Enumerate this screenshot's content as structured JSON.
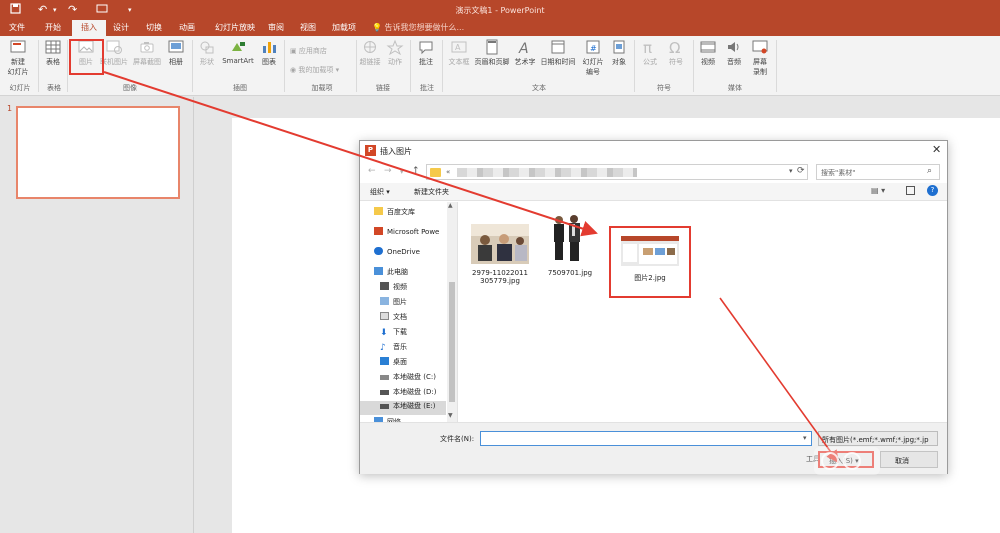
{
  "window": {
    "title": "演示文稿1 - PowerPoint"
  },
  "qat": {
    "save_icon": "save-icon",
    "undo_icon": "undo-icon",
    "redo_icon": "redo-icon",
    "present_icon": "present-icon"
  },
  "tabs": [
    "文件",
    "开始",
    "插入",
    "设计",
    "切换",
    "动画",
    "幻灯片放映",
    "审阅",
    "视图",
    "加载项"
  ],
  "tellme": "告诉我您想要做什么...",
  "ribbon": {
    "new_slide": "新建\n幻灯片",
    "table": "表格",
    "picture": "图片",
    "online_picture": "联机图片",
    "screenshot": "屏幕截图",
    "album": "相册",
    "shapes": "形状",
    "smartart": "SmartArt",
    "chart": "图表",
    "store": "应用商店",
    "my_addins": "我的加载项",
    "hyperlink": "超链接",
    "action": "动作",
    "comment": "批注",
    "textbox": "文本框",
    "header_footer": "页眉和页脚",
    "wordart": "艺术字",
    "datetime": "日期和时间",
    "slide_number": "幻灯片\n编号",
    "object": "对象",
    "equation": "公式",
    "symbol": "符号",
    "video": "视频",
    "audio": "音频",
    "screen_recording": "屏幕\n录制",
    "groups": {
      "slides": "幻灯片",
      "tables": "表格",
      "images": "图像",
      "illustrations": "插图",
      "addins": "加载项",
      "links": "链接",
      "comments": "批注",
      "text": "文本",
      "symbols": "符号",
      "media": "媒体"
    }
  },
  "thumbnails": {
    "slide_number": "1"
  },
  "dialog": {
    "title": "插入图片",
    "address_prefix": "«",
    "search_placeholder": "搜索\"素材\"",
    "organize": "组织 ▾",
    "new_folder": "新建文件夹",
    "nav": [
      {
        "label": "百度文库",
        "icon": "folder-icon"
      },
      {
        "label": "Microsoft Powe",
        "icon": "powerpoint-icon"
      },
      {
        "label": "OneDrive",
        "icon": "cloud-icon"
      },
      {
        "label": "此电脑",
        "icon": "computer-icon"
      },
      {
        "label": "视频",
        "icon": "video-folder-icon"
      },
      {
        "label": "图片",
        "icon": "pictures-folder-icon"
      },
      {
        "label": "文档",
        "icon": "documents-folder-icon"
      },
      {
        "label": "下载",
        "icon": "download-icon"
      },
      {
        "label": "音乐",
        "icon": "music-icon"
      },
      {
        "label": "桌面",
        "icon": "desktop-icon"
      },
      {
        "label": "本地磁盘 (C:)",
        "icon": "drive-icon"
      },
      {
        "label": "本地磁盘 (D:)",
        "icon": "drive-icon"
      },
      {
        "label": "本地磁盘 (E:)",
        "icon": "drive-icon"
      },
      {
        "label": "网络",
        "icon": "network-icon"
      }
    ],
    "files": [
      {
        "name": "2979-11022011\n305779.jpg"
      },
      {
        "name": "7509701.jpg"
      },
      {
        "name": "图片2.jpg"
      }
    ],
    "filename_label": "文件名(N):",
    "filename_value": "",
    "filetype": "所有图片(*.emf;*.wmf;*.jpg;*.jp",
    "tools": "工具(L) ▾",
    "insert": "插入(S) ▾",
    "cancel": "取消"
  },
  "colors": {
    "accent": "#b7472a",
    "highlight": "#e33b30",
    "selection": "#e8856a"
  }
}
